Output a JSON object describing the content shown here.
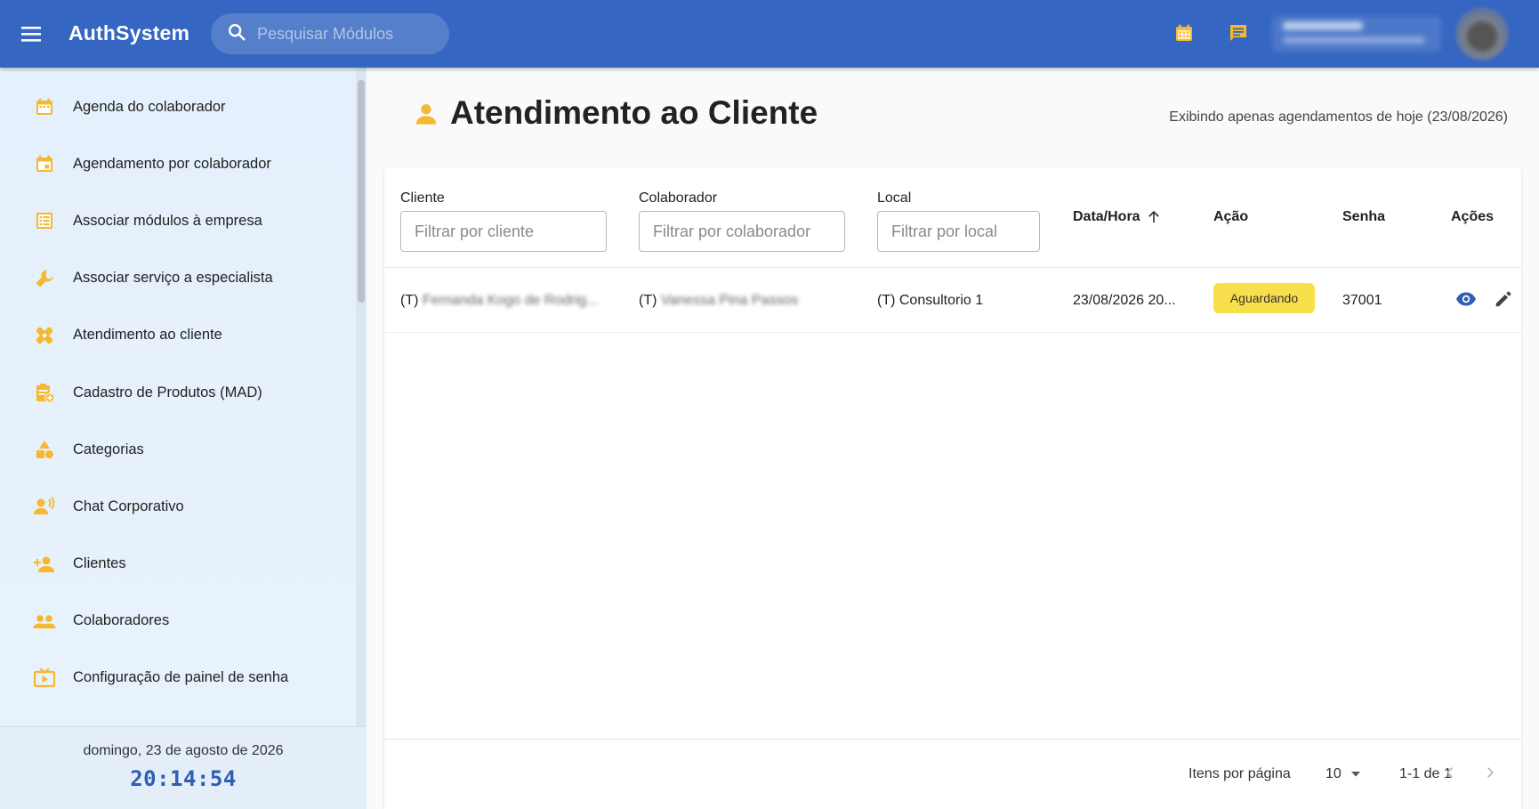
{
  "topbar": {
    "app_title": "AuthSystem",
    "search_placeholder": "Pesquisar Módulos",
    "user_name": "",
    "bg_color": "#3566c2"
  },
  "sidebar": {
    "items": [
      {
        "label": "Agenda do colaborador",
        "icon": "calendar-icon"
      },
      {
        "label": "Agendamento por colaborador",
        "icon": "event-icon"
      },
      {
        "label": "Associar módulos à empresa",
        "icon": "list-alt-icon"
      },
      {
        "label": "Associar serviço a especialista",
        "icon": "wrench-icon"
      },
      {
        "label": "Atendimento ao cliente",
        "icon": "healing-icon"
      },
      {
        "label": "Cadastro de Produtos (MAD)",
        "icon": "clipboard-add-icon"
      },
      {
        "label": "Categorias",
        "icon": "category-icon"
      },
      {
        "label": "Chat Corporativo",
        "icon": "voice-chat-icon"
      },
      {
        "label": "Clientes",
        "icon": "person-add-icon"
      },
      {
        "label": "Colaboradores",
        "icon": "group-icon"
      },
      {
        "label": "Configuração de painel de senha",
        "icon": "tv-play-icon"
      }
    ],
    "footer": {
      "date": "domingo, 23 de agosto de 2026",
      "time": "20:14:54"
    }
  },
  "main": {
    "title": "Atendimento ao Cliente",
    "note": "Exibindo apenas agendamentos de hoje (23/08/2026)",
    "table": {
      "columns": {
        "cliente": {
          "label": "Cliente",
          "placeholder": "Filtrar por cliente"
        },
        "colaborador": {
          "label": "Colaborador",
          "placeholder": "Filtrar por colaborador"
        },
        "local": {
          "label": "Local",
          "placeholder": "Filtrar por local"
        },
        "datahora": "Data/Hora",
        "acao": "Ação",
        "senha": "Senha",
        "acoes": "Ações"
      },
      "rows": [
        {
          "cliente_prefix": "(T)",
          "cliente": "Fernanda Kogo de Rodrig...",
          "colaborador_prefix": "(T)",
          "colaborador": "Vanessa Pina Passos",
          "local": "(T) Consultorio 1",
          "datahora": "23/08/2026 20...",
          "acao": "Aguardando",
          "senha": "37001"
        }
      ]
    },
    "paginator": {
      "items_per_page_label": "Itens por página",
      "page_size": "10",
      "range": "1-1 de 1"
    }
  },
  "colors": {
    "accent": "#f5b82e",
    "status_waiting": "#f8df4c",
    "clock": "#2f5fb3"
  }
}
